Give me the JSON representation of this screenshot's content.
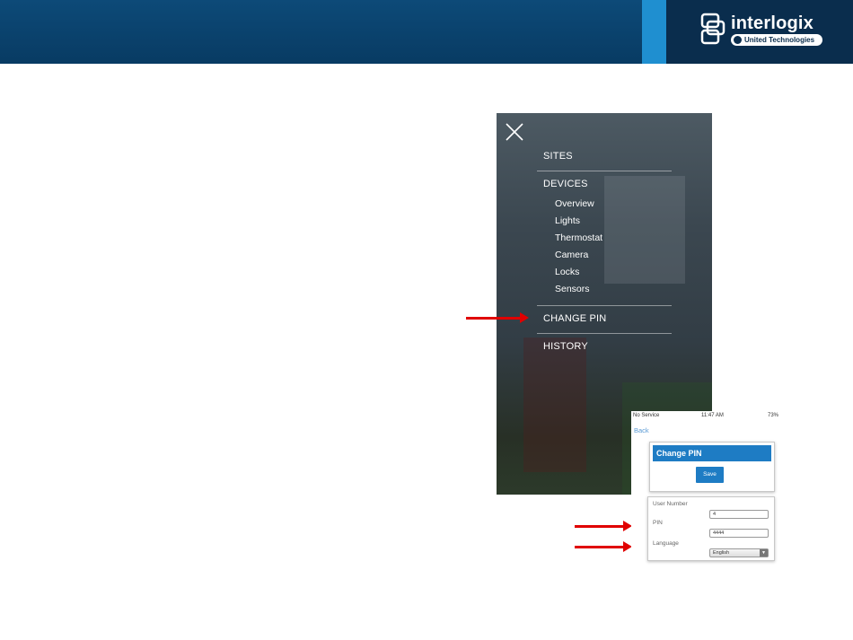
{
  "brand": {
    "name": "interlogix",
    "tagline": "United Technologies",
    "colors": {
      "header": "#0b426d",
      "accent": "#1f8fd0",
      "arrow": "#e00000",
      "button": "#1e7cc4"
    }
  },
  "menu": {
    "close_icon": "close-icon",
    "sections": [
      {
        "label": "SITES"
      },
      {
        "label": "DEVICES",
        "children": [
          "Overview",
          "Lights",
          "Thermostat",
          "Camera",
          "Locks",
          "Sensors"
        ]
      },
      {
        "label": "CHANGE PIN"
      },
      {
        "label": "HISTORY"
      }
    ]
  },
  "phone": {
    "status": {
      "carrier": "No Service",
      "time": "11:47 AM",
      "battery": "73%"
    },
    "back_label": "Back",
    "title": "Change PIN",
    "save_label": "Save",
    "fields": {
      "user_number_label": "User Number",
      "user_number_value": "4",
      "pin_label": "PIN",
      "pin_value": "4444",
      "language_label": "Language",
      "language_value": "English"
    }
  }
}
